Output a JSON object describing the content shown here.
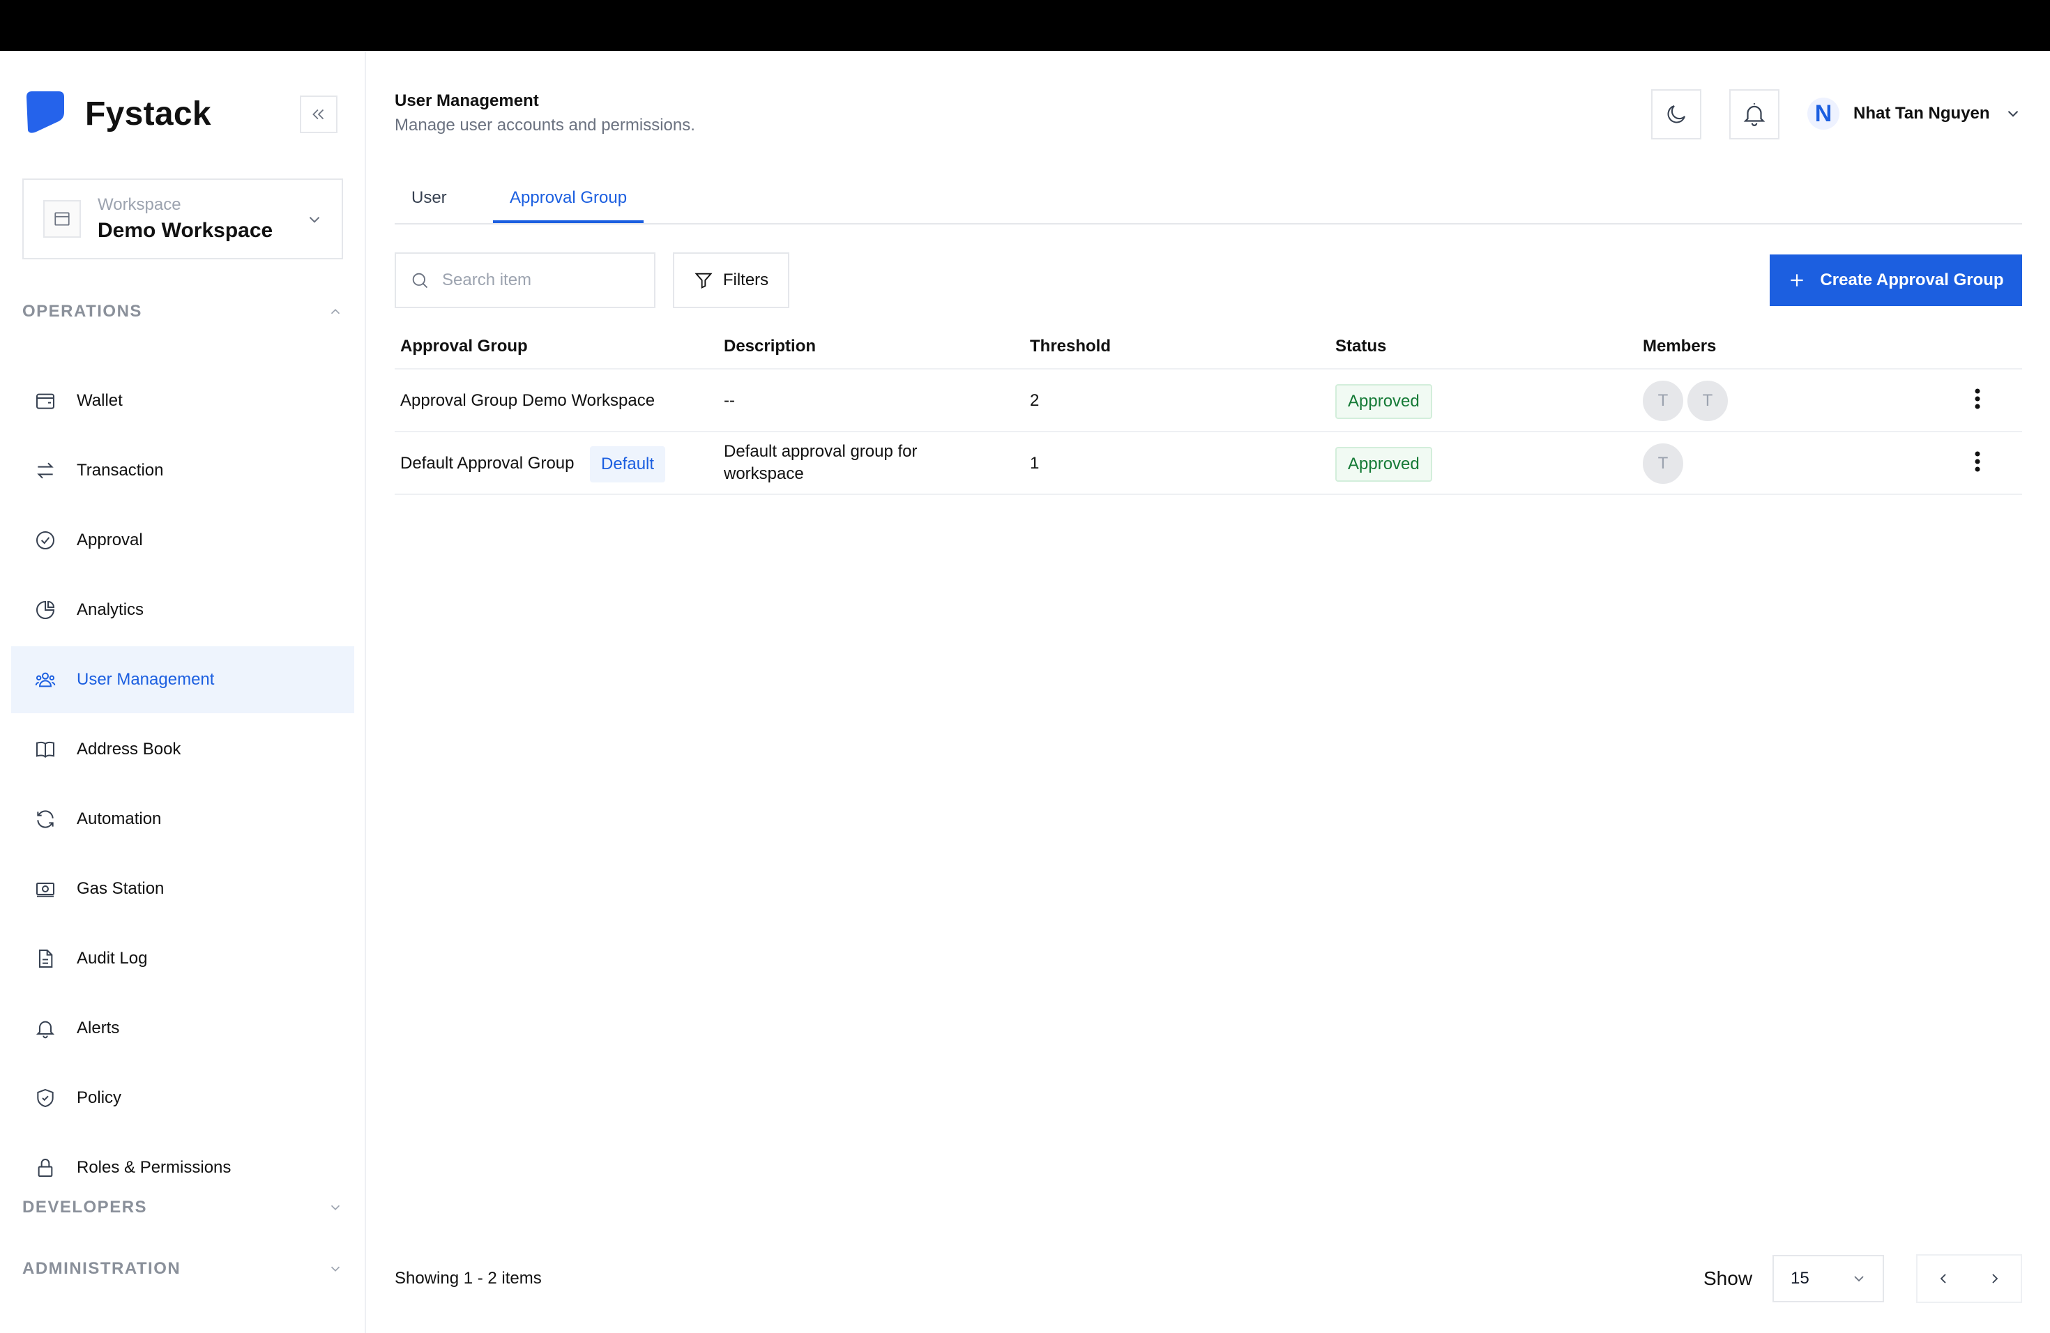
{
  "brand": {
    "name": "Fystack",
    "accent_color": "#1c5fe0"
  },
  "workspace": {
    "label": "Workspace",
    "name": "Demo Workspace"
  },
  "sidebar": {
    "sections": {
      "operations": "OPERATIONS",
      "developers": "DEVELOPERS",
      "administration": "ADMINISTRATION"
    },
    "items": [
      {
        "label": "Wallet",
        "icon": "wallet-icon"
      },
      {
        "label": "Transaction",
        "icon": "transfer-arrows-icon"
      },
      {
        "label": "Approval",
        "icon": "check-circle-icon"
      },
      {
        "label": "Analytics",
        "icon": "pie-chart-icon"
      },
      {
        "label": "User Management",
        "icon": "users-icon",
        "active": true
      },
      {
        "label": "Address Book",
        "icon": "book-icon"
      },
      {
        "label": "Automation",
        "icon": "refresh-icon"
      },
      {
        "label": "Gas Station",
        "icon": "banknote-icon"
      },
      {
        "label": "Audit Log",
        "icon": "document-icon"
      },
      {
        "label": "Alerts",
        "icon": "bell-icon"
      },
      {
        "label": "Policy",
        "icon": "shield-check-icon"
      },
      {
        "label": "Roles & Permissions",
        "icon": "lock-icon"
      }
    ]
  },
  "header": {
    "title": "User Management",
    "subtitle": "Manage user accounts and permissions.",
    "user": {
      "initial": "N",
      "name": "Nhat Tan Nguyen"
    }
  },
  "tabs": [
    {
      "label": "User"
    },
    {
      "label": "Approval Group",
      "active": true
    }
  ],
  "toolbar": {
    "search_placeholder": "Search item",
    "filters_label": "Filters",
    "create_label": "Create Approval Group"
  },
  "table": {
    "columns": [
      "Approval Group",
      "Description",
      "Threshold",
      "Status",
      "Members"
    ],
    "rows": [
      {
        "name": "Approval Group Demo Workspace",
        "description": "--",
        "threshold": "2",
        "status": "Approved",
        "members": [
          "T",
          "T"
        ]
      },
      {
        "name": "Default Approval Group",
        "badge": "Default",
        "description_line1": "Default approval group for",
        "description_line2": "workspace",
        "threshold": "1",
        "status": "Approved",
        "members": [
          "T"
        ]
      }
    ]
  },
  "footer": {
    "showing": "Showing 1 - 2 items",
    "show_label": "Show",
    "page_size": "15"
  }
}
